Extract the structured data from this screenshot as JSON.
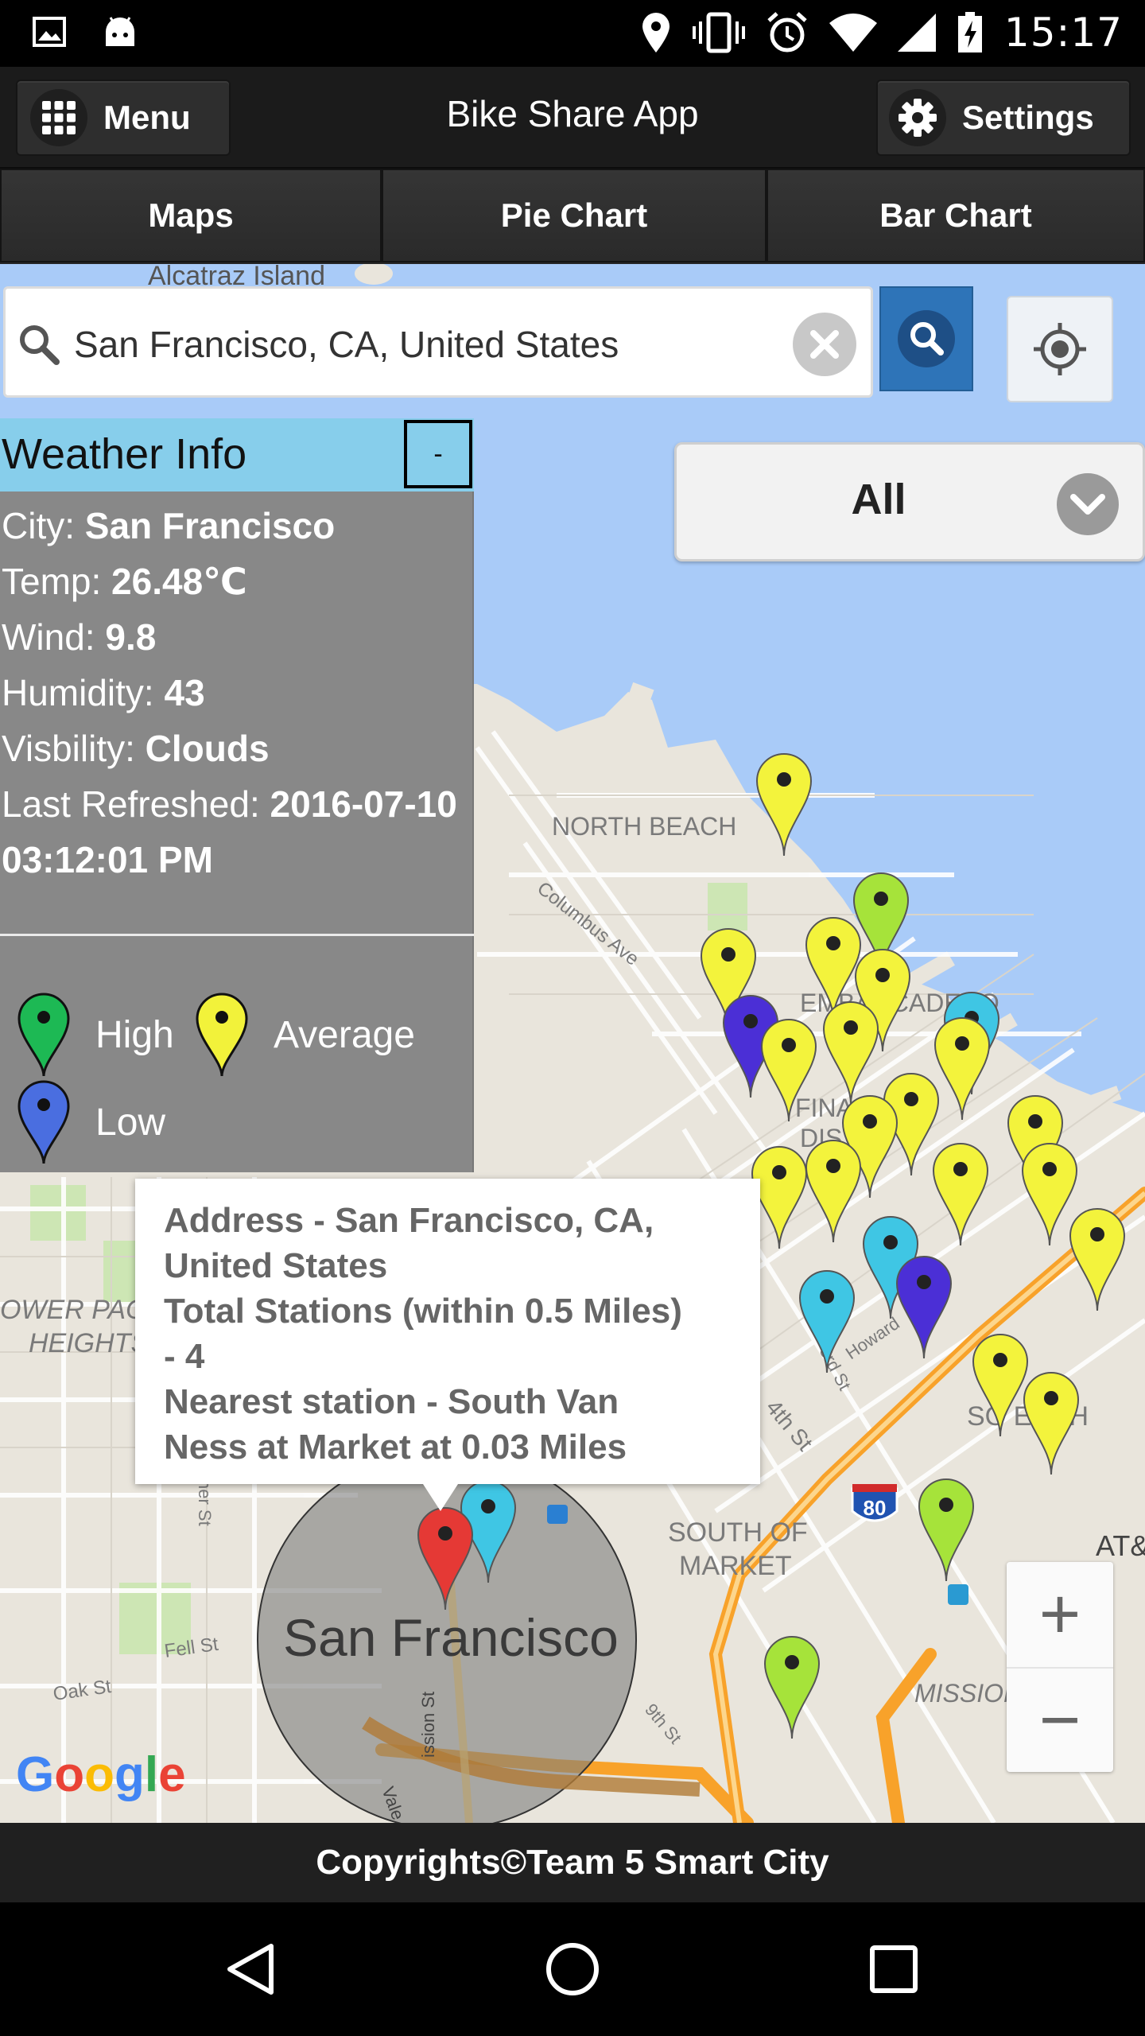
{
  "status_bar": {
    "time": "15:17",
    "left_icons": [
      "image-icon",
      "android-icon"
    ],
    "right_icons": [
      "location-icon",
      "vibrate-icon",
      "alarm-icon",
      "wifi-icon",
      "signal-icon",
      "battery-charging-icon"
    ]
  },
  "header": {
    "title": "Bike Share App",
    "menu_label": "Menu",
    "settings_label": "Settings"
  },
  "tabs": [
    {
      "label": "Maps"
    },
    {
      "label": "Pie Chart"
    },
    {
      "label": "Bar Chart"
    }
  ],
  "search": {
    "value": "San Francisco, CA, United States"
  },
  "filter": {
    "selected": "All"
  },
  "weather": {
    "title": "Weather Info",
    "collapse_label": "-",
    "rows": [
      {
        "label": "City: ",
        "value": "San Francisco"
      },
      {
        "label": "Temp: ",
        "value": "26.48℃"
      },
      {
        "label": "Wind: ",
        "value": "9.8"
      },
      {
        "label": "Humidity: ",
        "value": "43"
      },
      {
        "label": "Visbility: ",
        "value": "Clouds"
      },
      {
        "label": "Last Refreshed: ",
        "value": "2016-07-10 03:12:01 PM"
      }
    ],
    "legend": [
      {
        "label": "High",
        "color": "#1db954"
      },
      {
        "label": "Average",
        "color": "#f2f23a"
      },
      {
        "label": "Low",
        "color": "#4a6ee0"
      }
    ]
  },
  "map": {
    "labels": {
      "alcatraz": "Alcatraz Island",
      "north_beach": "NORTH BEACH",
      "columbus": "Columbus Ave",
      "embarcadero": "EMBARCADERO",
      "financial": "FINA",
      "financial2": "DIS",
      "lower_pac": "OWER PAC",
      "heights": "HEIGHTS",
      "south_of": "SOUTH OF",
      "market": "MARKET",
      "city": "San Francisco",
      "mission_bay": "MISSION BAY",
      "south_beach": "SO    EACH",
      "att": "AT&",
      "fourth": "4th St",
      "third": "3rd St",
      "howard": "Howard",
      "ninth": "9th St",
      "fell": "Fell St",
      "oak": "Oak St",
      "mission": "ission St",
      "valencia": "Vale",
      "ner": "ner St",
      "hwy": "80",
      "google": "Google"
    },
    "colors": {
      "water": "#a9cbf8",
      "land": "#e9e5dc",
      "park": "#cde6b4",
      "highway": "#f8a22a",
      "yellow_pin": "#f3f33c",
      "green_pin": "#a6e33a",
      "cyan_pin": "#3fc6e4",
      "blue_pin": "#4b2fd6",
      "red_pin": "#e53935"
    }
  },
  "info_window": {
    "lines": [
      "Address - San Francisco, CA,",
      "United States",
      "Total Stations (within 0.5 Miles)",
      "- 4",
      "Nearest station - South Van",
      "Ness at Market at 0.03 Miles"
    ]
  },
  "zoom": {
    "in_label": "+",
    "out_label": "−"
  },
  "footer": {
    "text": "Copyrights©Team 5 Smart City"
  },
  "nav": [
    "back-icon",
    "home-icon",
    "recents-icon"
  ]
}
